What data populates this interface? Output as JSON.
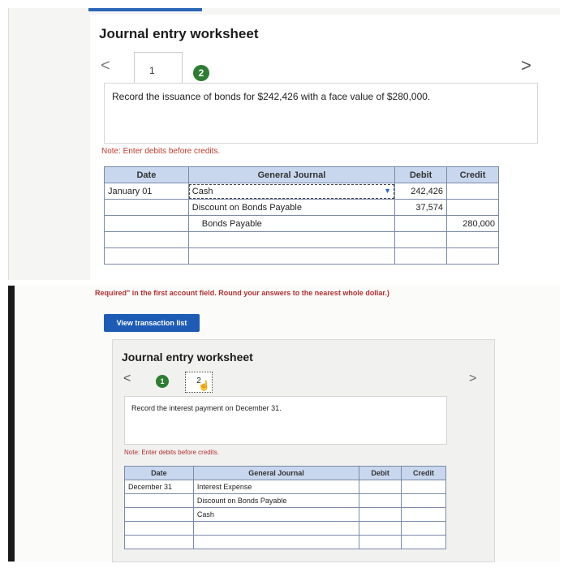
{
  "top": {
    "title": "Journal entry worksheet",
    "nav_prev": "<",
    "nav_next": ">",
    "tab1": "1",
    "tab2": "2",
    "instruction": "Record the issuance of bonds for $242,426 with a face value of $280,000.",
    "note": "Note: Enter debits before credits.",
    "headers": [
      "Date",
      "General Journal",
      "Debit",
      "Credit"
    ],
    "rows": [
      {
        "date": "January 01",
        "account": "Cash",
        "debit": "242,426",
        "credit": ""
      },
      {
        "date": "",
        "account": "Discount on Bonds Payable",
        "debit": "37,574",
        "credit": ""
      },
      {
        "date": "",
        "account": "Bonds Payable",
        "debit": "",
        "credit": "280,000"
      }
    ]
  },
  "bottom": {
    "required_note": "Required\" in the first account field. Round your answers to the nearest whole dollar.)",
    "view_button": "View transaction list",
    "title": "Journal entry worksheet",
    "nav_prev": "<",
    "nav_next": ">",
    "tab1": "1",
    "tab2": "2",
    "instruction": "Record the interest payment on December 31.",
    "note": "Note: Enter debits before credits.",
    "headers": [
      "Date",
      "General Journal",
      "Debit",
      "Credit"
    ],
    "rows": [
      {
        "date": "December 31",
        "account": "Interest Expense",
        "debit": "",
        "credit": ""
      },
      {
        "date": "",
        "account": "Discount on Bonds Payable",
        "debit": "",
        "credit": ""
      },
      {
        "date": "",
        "account": "Cash",
        "debit": "",
        "credit": ""
      }
    ]
  },
  "colors": {
    "accent": "#1e5bb5",
    "step_done": "#2e7d32",
    "note_red": "#c0392b",
    "header_bg": "#c9d7ee"
  },
  "icons": [
    "chevron-left-icon",
    "chevron-right-icon",
    "pointer-hand-icon",
    "dropdown-arrow-icon"
  ]
}
